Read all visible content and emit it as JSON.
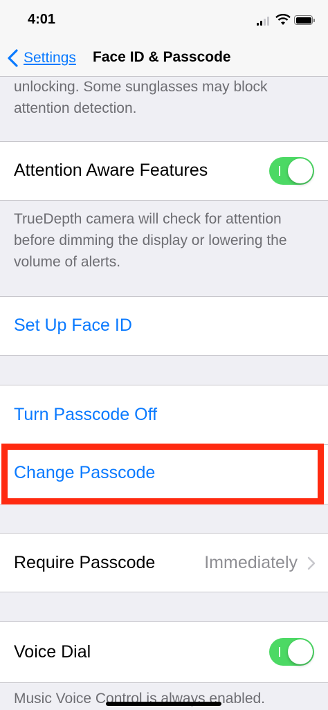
{
  "status_bar": {
    "time": "4:01",
    "icons": [
      "signal-icon",
      "wifi-icon",
      "battery-icon"
    ]
  },
  "nav": {
    "back_label": "Settings",
    "title": "Face ID & Passcode"
  },
  "sections": {
    "top_footer": {
      "text": "unlocking. Some sunglasses may block attention detection."
    },
    "attention": {
      "label": "Attention Aware Features",
      "toggle_on": true,
      "footer": "TrueDepth camera will check for attention before dimming the display or lowering the volume of alerts."
    },
    "setup": {
      "label": "Set Up Face ID"
    },
    "passcode": {
      "turn_off_label": "Turn Passcode Off",
      "change_label": "Change Passcode"
    },
    "require": {
      "label": "Require Passcode",
      "value": "Immediately"
    },
    "voice": {
      "label": "Voice Dial",
      "toggle_on": true,
      "footer": "Music Voice Control is always enabled."
    }
  },
  "colors": {
    "accent": "#0a7aff",
    "toggle_on": "#4cd964",
    "highlight": "#ff2a10"
  }
}
